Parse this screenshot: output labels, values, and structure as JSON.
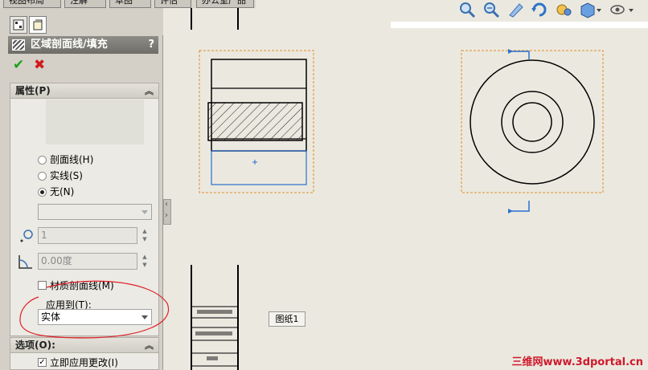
{
  "top_tabs": [
    "视图布局",
    "注解",
    "草图",
    "评估",
    "办公室产品"
  ],
  "panel": {
    "title": "区域剖面线/填充",
    "help": "?",
    "ok_icon": "check-icon",
    "cancel_icon": "x-icon",
    "ok_color": "#1aa31a",
    "cancel_color": "#d21a1a"
  },
  "properties": {
    "header": "属性(P)",
    "radios": [
      {
        "label": "剖面线(H)",
        "selected": false
      },
      {
        "label": "实线(S)",
        "selected": false
      },
      {
        "label": "无(N)",
        "selected": true
      }
    ],
    "pattern_value": "",
    "scale_value": "1",
    "angle_value": "0.00度",
    "material_hatch_label": "材质剖面线(M)",
    "apply_to_label": "应用到(T):",
    "apply_to_value": "实体"
  },
  "options": {
    "header": "选项(O):",
    "apply_immediately_label": "立即应用更改(I)"
  },
  "sheet_tab": "图纸1",
  "watermark": "三维网www.3dportal.cn",
  "colors": {
    "highlight": "#e0202a",
    "frame": "#e08a2a",
    "blue": "#2a6fd0"
  }
}
